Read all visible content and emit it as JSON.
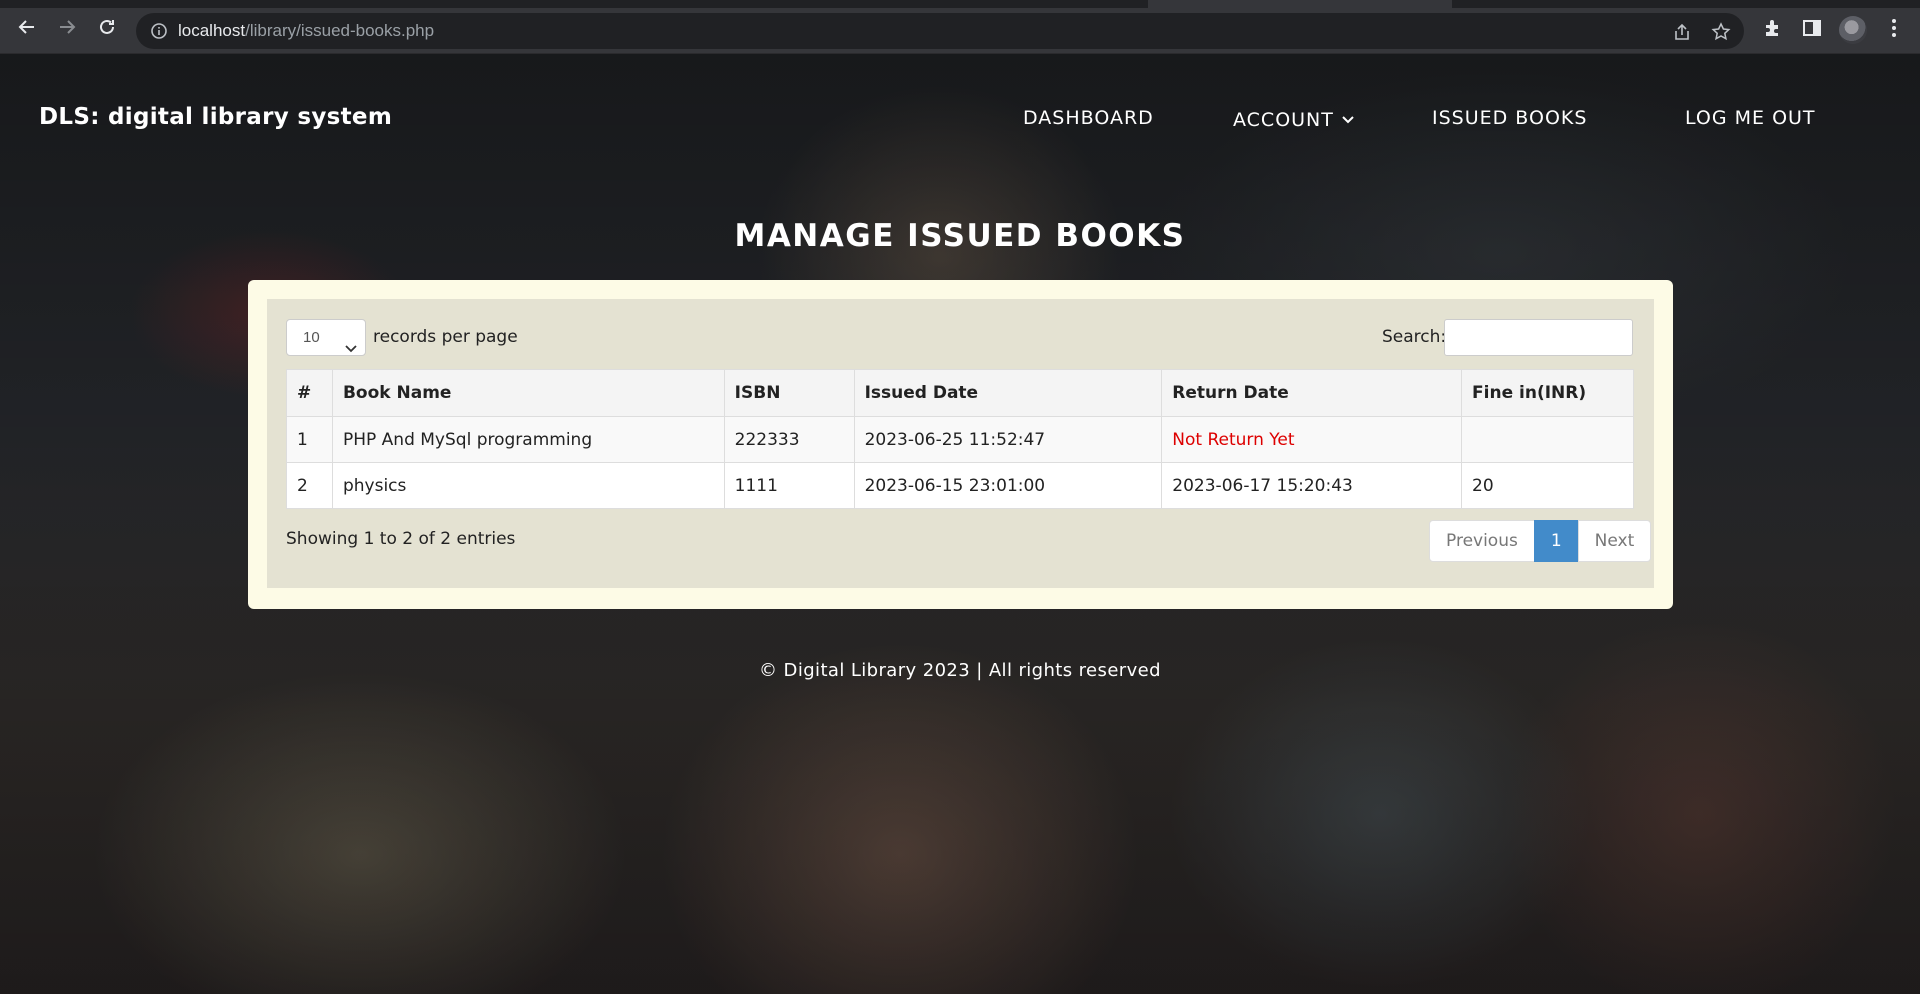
{
  "browser": {
    "url_host": "localhost",
    "url_path": "/library/issued-books.php"
  },
  "navbar": {
    "brand": "DLS: digital library system",
    "items": [
      {
        "label": "DASHBOARD"
      },
      {
        "label": "ACCOUNT"
      },
      {
        "label": "ISSUED BOOKS"
      },
      {
        "label": "LOG ME OUT"
      }
    ]
  },
  "page": {
    "heading": "MANAGE ISSUED BOOKS"
  },
  "table_controls": {
    "page_length": "10",
    "page_length_label": "records per page",
    "search_label": "Search:",
    "search_value": ""
  },
  "table": {
    "headers": [
      "#",
      "Book Name",
      "ISBN",
      "Issued Date",
      "Return Date",
      "Fine in(INR)"
    ],
    "rows": [
      {
        "num": "1",
        "book": "PHP And MySql programming",
        "isbn": "222333",
        "issued": "2023-06-25 11:52:47",
        "returned": "Not Return Yet",
        "fine": ""
      },
      {
        "num": "2",
        "book": "physics",
        "isbn": "1111",
        "issued": "2023-06-15 23:01:00",
        "returned": "2023-06-17 15:20:43",
        "fine": "20"
      }
    ]
  },
  "table_footer": {
    "info": "Showing 1 to 2 of 2 entries",
    "prev_label": "Previous",
    "current_page": "1",
    "next_label": "Next"
  },
  "footer": {
    "text": "© Digital Library 2023 | All rights reserved"
  },
  "colors": {
    "not_returned": "#dd0000",
    "pager_active": "#428bca",
    "panel_bg": "#e4e2d2"
  }
}
